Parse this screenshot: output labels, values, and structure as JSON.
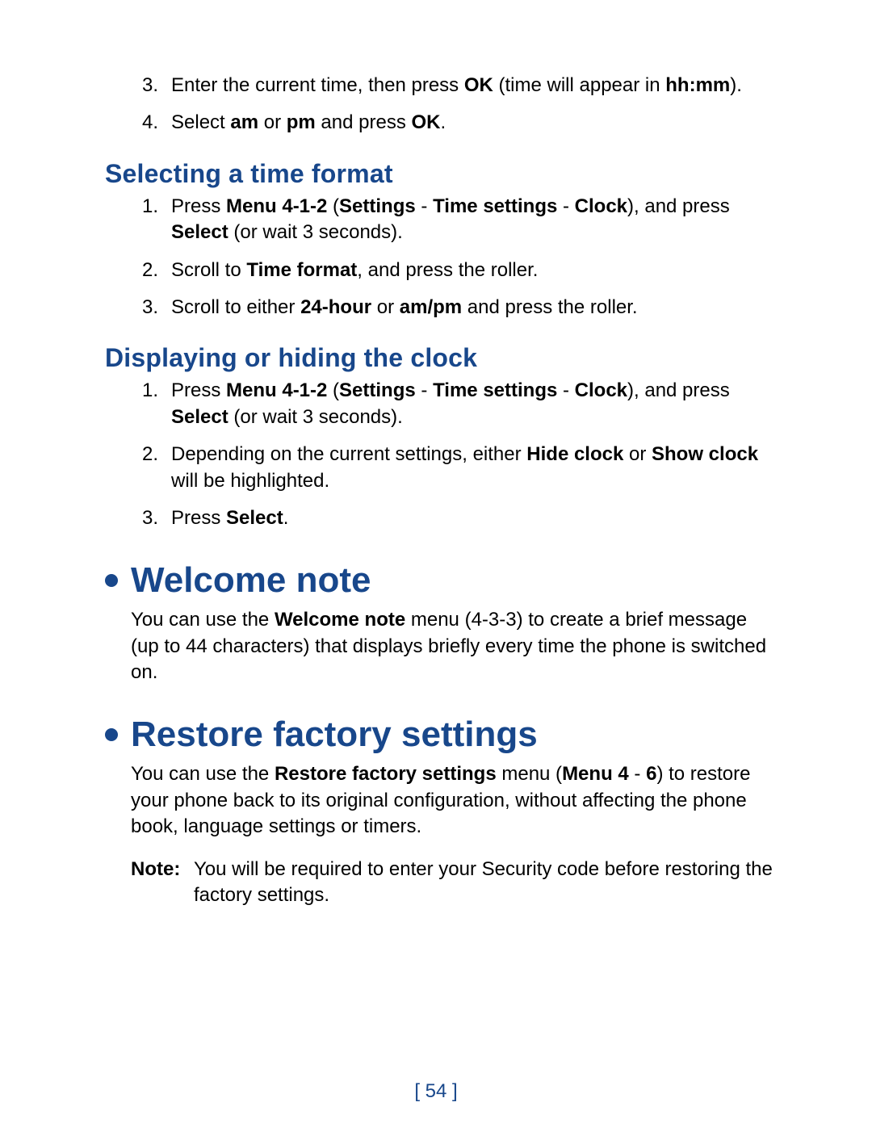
{
  "list_top": [
    {
      "num": "3.",
      "html": "Enter the current time, then press <b>OK</b> (time will appear in <b>hh:mm</b>)."
    },
    {
      "num": "4.",
      "html": "Select <b>am</b> or <b>pm</b> and press <b>OK</b>."
    }
  ],
  "subhead_time_format": "Selecting a time format",
  "list_time_format": [
    {
      "num": "1.",
      "html": "Press <b>Menu 4-1-2</b> (<b>Settings</b> - <b>Time settings</b> - <b>Clock</b>), and press <b>Select</b> (or wait 3 seconds)."
    },
    {
      "num": "2.",
      "html": "Scroll to <b>Time format</b>, and press the roller."
    },
    {
      "num": "3.",
      "html": "Scroll to either <b>24-hour</b> or <b>am/pm</b> and press the roller."
    }
  ],
  "subhead_display_clock": "Displaying or hiding the clock",
  "list_display_clock": [
    {
      "num": "1.",
      "html": "Press <b>Menu 4-1-2</b> (<b>Settings</b> - <b>Time settings</b> - <b>Clock</b>), and press <b>Select</b> (or wait 3 seconds)."
    },
    {
      "num": "2.",
      "html": "Depending on the current settings, either <b>Hide clock</b> or <b>Show clock</b> will be highlighted."
    },
    {
      "num": "3.",
      "html": "Press <b>Select</b>."
    }
  ],
  "head_welcome": "Welcome note",
  "para_welcome": "You can use the <b>Welcome note</b> menu (4-3-3) to create a brief message (up to 44 characters) that displays briefly every time the phone is switched on.",
  "head_restore": "Restore factory settings",
  "para_restore": "You can use the <b>Restore factory settings</b> menu (<b>Menu 4</b> - <b>6</b>) to restore your phone back to its original configuration, without affecting the phone book, language settings or timers.",
  "note_label": "Note:",
  "note_body": "You will be required to enter your Security code before restoring the factory settings.",
  "page_number": "[ 54 ]"
}
